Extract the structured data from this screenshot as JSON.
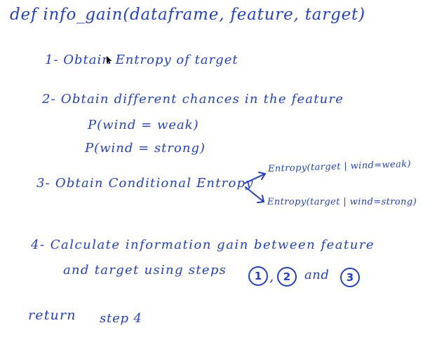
{
  "notes": {
    "title": "def info_gain(dataframe, feature, target)",
    "step1": "1- Obtain Entropy of target",
    "step2": "2- Obtain different chances in the feature",
    "p_weak": "P(wind = weak)",
    "p_strong": "P(wind = strong)",
    "step3": "3- Obtain Conditional Entropy",
    "branch_weak": "Entropy(target | wind=weak)",
    "branch_strong": "Entropy(target | wind=strong)",
    "step4_line1": "4- Calculate information gain between feature",
    "step4_line2": "and target using steps",
    "comma": ",",
    "and_word": "and",
    "ref_1": "1",
    "ref_2": "2",
    "ref_3": "3",
    "return_kw": "return",
    "return_val": "step 4"
  },
  "colors": {
    "ink": "#1f3fd6",
    "background": "#ffffff"
  },
  "icons": {
    "cursor": "mouse-pointer-icon",
    "branch_arrows": "arrow-right-icon"
  }
}
